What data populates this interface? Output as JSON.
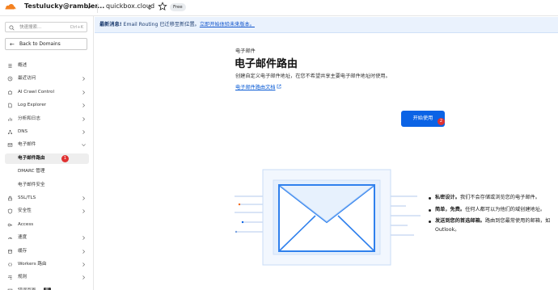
{
  "topbar": {
    "account": "Testulucky@rambler...",
    "domain": "quickbox.cloud",
    "plan": "Free"
  },
  "sidebar": {
    "search_placeholder": "快速搜索...",
    "search_shortcut": "Ctrl+K",
    "back_label": "Back to Domains",
    "items": [
      {
        "label": "概述",
        "icon": "list-icon",
        "chevron": false
      },
      {
        "label": "最近访问",
        "icon": "clock-icon",
        "chevron": true
      },
      {
        "label": "AI Crawl Control",
        "icon": "robot-icon",
        "chevron": true
      },
      {
        "label": "Log Explorer",
        "icon": "document-icon",
        "chevron": true
      },
      {
        "label": "分析和日志",
        "icon": "chart-icon",
        "chevron": true
      },
      {
        "label": "DNS",
        "icon": "network-icon",
        "chevron": true
      },
      {
        "label": "电子邮件",
        "icon": "mail-icon",
        "chevron": true,
        "expanded": true
      },
      {
        "label": "电子邮件路由",
        "icon": "",
        "chevron": false,
        "active": true,
        "badge": "1"
      },
      {
        "label": "DMARC 管理",
        "icon": "",
        "chevron": false
      },
      {
        "label": "电子邮件安全",
        "icon": "",
        "chevron": false
      },
      {
        "label": "SSL/TLS",
        "icon": "lock-icon",
        "chevron": true
      },
      {
        "label": "安全性",
        "icon": "shield-icon",
        "chevron": true
      },
      {
        "label": "Access",
        "icon": "key-icon",
        "chevron": false
      },
      {
        "label": "速度",
        "icon": "speed-icon",
        "chevron": true
      },
      {
        "label": "缓存",
        "icon": "database-icon",
        "chevron": true
      },
      {
        "label": "Workers 路由",
        "icon": "workers-icon",
        "chevron": true
      },
      {
        "label": "规则",
        "icon": "rules-icon",
        "chevron": true
      },
      {
        "label": "错误页面",
        "icon": "error-page-icon",
        "chevron": false,
        "new_badge": "新"
      }
    ]
  },
  "banner": {
    "prefix": "最新消息!",
    "text": " Email Routing 已迁移至新位置。",
    "link": "立即开始体验未来版本。"
  },
  "main": {
    "kicker": "电子邮件",
    "title": "电子邮件路由",
    "description": "创建自定义电子邮件地址，在您不希望共享主要电子邮件地址时使用。",
    "doc_link": "电子邮件路由文档",
    "cta_label": "开始使用",
    "cta_badge": "2",
    "bullets": [
      {
        "bold": "私密设计。",
        "text": "我们不会存储或浏览您的电子邮件。"
      },
      {
        "bold": "简单，免费。",
        "text": "任何人都可以为他们的域创建地址。"
      },
      {
        "bold": "发送到您的首选邮箱。",
        "text": "路由到您最常使用的邮箱，如 Outlook。"
      }
    ]
  },
  "colors": {
    "accent": "#0b63e5",
    "badge": "#e03131",
    "banner_bg": "#eaf2fd"
  }
}
